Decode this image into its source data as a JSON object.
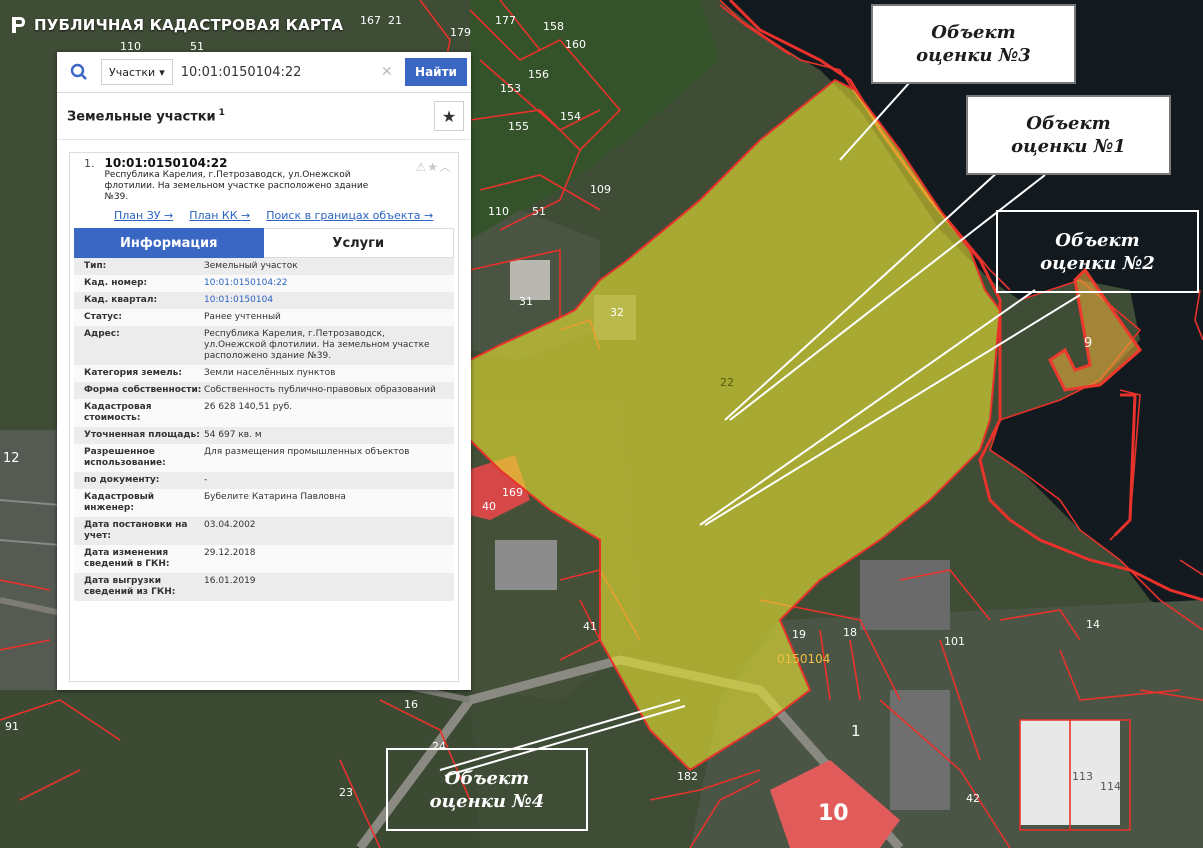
{
  "app": {
    "title": "ПУБЛИЧНАЯ КАДАСТРОВАЯ КАРТА"
  },
  "search": {
    "type_label": "Участки",
    "query": "10:01:0150104:22",
    "find_label": "Найти"
  },
  "section": {
    "title": "Земельные участки",
    "count": "1"
  },
  "result": {
    "number": "1.",
    "cad_number": "10:01:0150104:22",
    "address": "Республика Карелия, г.Петрозаводск, ул.Онежской флотилии. На земельном участке расположено здание №39.",
    "links": [
      "План ЗУ →",
      "План КК →",
      "Поиск в границах объекта →"
    ]
  },
  "tabs": [
    "Информация",
    "Услуги"
  ],
  "info_rows": [
    {
      "label": "Тип:",
      "value": "Земельный участок"
    },
    {
      "label": "Кад. номер:",
      "value": "10:01:0150104:22"
    },
    {
      "label": "Кад. квартал:",
      "value": "10:01:0150104"
    },
    {
      "label": "Статус:",
      "value": "Ранее учтенный"
    },
    {
      "label": "Адрес:",
      "value": "Республика Карелия, г.Петрозаводск, ул.Онежской флотилии. На земельном участке расположено здание №39."
    },
    {
      "label": "Категория земель:",
      "value": "Земли населённых пунктов"
    },
    {
      "label": "Форма собственности:",
      "value": "Собственность публично-правовых образований"
    },
    {
      "label": "Кадастровая стоимость:",
      "value": "26 628 140,51 руб."
    },
    {
      "label": "Уточненная площадь:",
      "value": "54 697 кв. м"
    },
    {
      "label": "Разрешенное использование:",
      "value": "Для размещения промышленных объектов"
    },
    {
      "label": "по документу:",
      "value": "-"
    },
    {
      "label": "Кадастровый инженер:",
      "value": "Бубелите Катарина Павловна"
    },
    {
      "label": "Дата постановки на учет:",
      "value": "03.04.2002"
    },
    {
      "label": "Дата изменения сведений в ГКН:",
      "value": "29.12.2018"
    },
    {
      "label": "Дата выгрузки сведений из ГКН:",
      "value": "16.01.2019"
    }
  ],
  "callouts": {
    "obj1": {
      "line1": "Объект",
      "line2": "оценки №1"
    },
    "obj2": {
      "line1": "Объект",
      "line2": "оценки №2"
    },
    "obj3": {
      "line1": "Объект",
      "line2": "оценки №3"
    },
    "obj4": {
      "line1": "Объект",
      "line2": "оценки  №4"
    }
  },
  "map_labels": {
    "parcel": "22",
    "quarter": "0150104",
    "n167": "167",
    "n21": "21",
    "n179": "179",
    "n177": "177",
    "n158": "158",
    "n160": "160",
    "n156": "156",
    "n153": "153",
    "n155": "155",
    "n154": "154",
    "n110t": "110",
    "n51t": "51",
    "n109": "109",
    "n110": "110",
    "n51": "51",
    "n31": "31",
    "n32": "32",
    "n9": "9",
    "n40": "40",
    "n169": "169",
    "n12": "12",
    "n41": "41",
    "n19": "19",
    "n18": "18",
    "n101": "101",
    "n14": "14",
    "n1": "1",
    "n16": "16",
    "n91": "91",
    "n23": "23",
    "n24": "24",
    "n182": "182",
    "n10": "10",
    "n42": "42",
    "n113": "113",
    "n114": "114"
  },
  "colors": {
    "accent": "#3b67c4",
    "parcel_fill": "#e6e232",
    "boundary": "#e8322b",
    "water": "#121a20"
  }
}
